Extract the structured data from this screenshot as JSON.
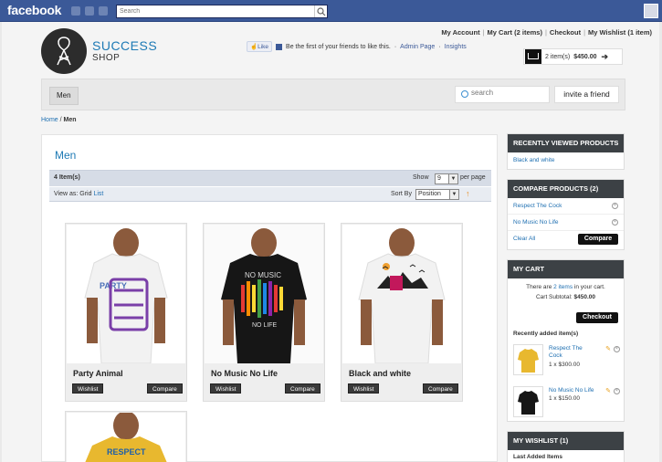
{
  "facebook": {
    "logo": "facebook",
    "search_placeholder": "Search"
  },
  "store": {
    "logo_line1": "SUCCESS",
    "logo_line2": "SHOP"
  },
  "header": {
    "links": [
      "My Account",
      "My Cart (2 items)",
      "Checkout",
      "My Wishlist (1 item)"
    ],
    "like_label": "Like",
    "like_text": "Be the first of your friends to like this.",
    "admin_page": "Admin Page",
    "insights": "Insights",
    "minicart_items": "2 item(s)",
    "minicart_total": "$450.00"
  },
  "nav": {
    "category": "Men",
    "search_placeholder": "search",
    "invite": "invite a friend"
  },
  "breadcrumb": {
    "home": "Home",
    "sep": " / ",
    "current": "Men"
  },
  "main": {
    "title": "Men",
    "item_count": "4 Item(s)",
    "show_label": "Show",
    "per_page_value": "9",
    "per_page_label": "per page",
    "view_as": "View as: Grid",
    "list_link": "List",
    "sort_label": "Sort By",
    "sort_value": "Position"
  },
  "products": [
    {
      "name": "Party Animal",
      "wishlist": "Wishlist",
      "compare": "Compare",
      "shirt_color": "#f2f2f2"
    },
    {
      "name": "No Music No Life",
      "wishlist": "Wishlist",
      "compare": "Compare",
      "shirt_color": "#161616"
    },
    {
      "name": "Black and white",
      "wishlist": "Wishlist",
      "compare": "Compare",
      "shirt_color": "#f2f2f2"
    },
    {
      "name": "",
      "shirt_color": "#e8b82f"
    }
  ],
  "sidebar": {
    "recently_viewed": {
      "title": "RECENTLY VIEWED PRODUCTS",
      "items": [
        "Black and white"
      ]
    },
    "compare": {
      "title": "COMPARE PRODUCTS (2)",
      "items": [
        "Respect The Cock",
        "No Music No Life"
      ],
      "clear_all": "Clear All",
      "compare_btn": "Compare"
    },
    "cart": {
      "title": "MY CART",
      "there_are": "There are",
      "items_link": "2 items",
      "in_cart": "in your cart.",
      "subtotal_label": "Cart Subtotal:",
      "subtotal": "$450.00",
      "checkout": "Checkout",
      "recent_label": "Recently added item(s)",
      "items": [
        {
          "name": "Respect The Cock",
          "qty": "1 x $300.00",
          "shirt_color": "#e8b82f"
        },
        {
          "name": "No Music No Life",
          "qty": "1 x $150.00",
          "shirt_color": "#161616"
        }
      ]
    },
    "wishlist": {
      "title": "MY WISHLIST (1)",
      "last_added": "Last Added Items"
    }
  },
  "colors": {
    "facebook_blue": "#3b5998",
    "link_blue": "#1e6fb1",
    "sidebar_header": "#3c4145"
  }
}
